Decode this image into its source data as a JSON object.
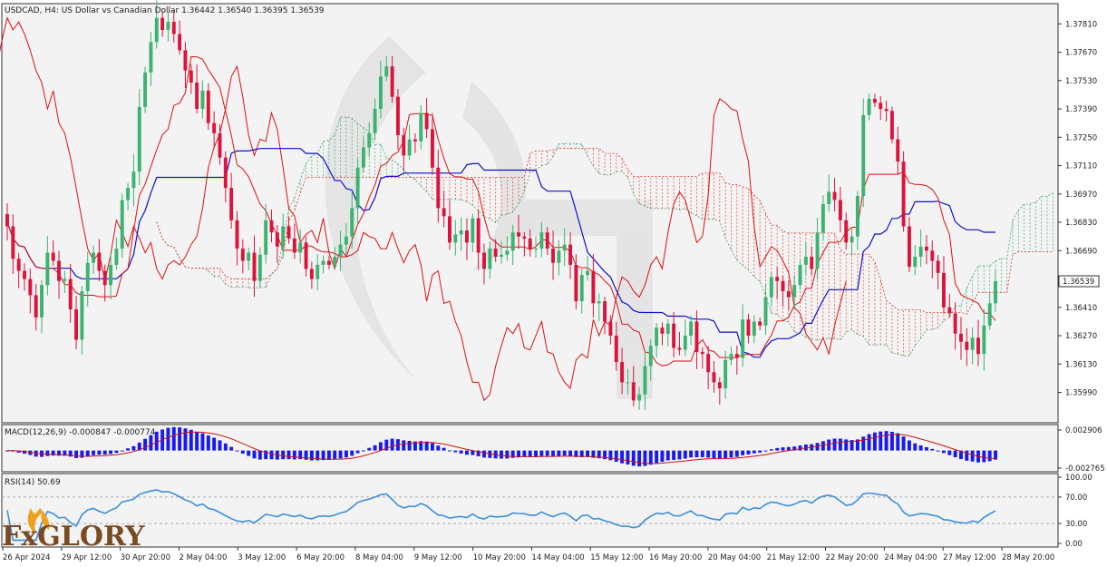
{
  "header": {
    "text": "USDCAD, H4:  US Dollar vs Canadian Dollar  1.36442 1.36540 1.36395 1.36539"
  },
  "logo": {
    "text": "FxGlory"
  },
  "colors": {
    "bull": "#3cb371",
    "bear": "#dc143c",
    "kijun": "#1010cc",
    "tenkan": "#dd1111",
    "cloud_bear": "#e0302a",
    "cloud_bull": "#3aa564",
    "macd_hist": "#1a1aee",
    "macd_signal": "#cc1111",
    "rsi": "#3c8fdc",
    "background": "#f3f3f3"
  },
  "chart_data": [
    {
      "type": "candlestick",
      "panel": "main",
      "symbol": "USDCAD",
      "timeframe": "H4",
      "description": "US Dollar vs Canadian Dollar",
      "last_price_label": "1.36539",
      "ylim": [
        1.3584,
        1.3791
      ],
      "y_ticks": [
        "1.37810",
        "1.37670",
        "1.37530",
        "1.37390",
        "1.37250",
        "1.37110",
        "1.36970",
        "1.36830",
        "1.36690",
        "1.36539",
        "1.36410",
        "1.36270",
        "1.36130",
        "1.35990"
      ],
      "x_labels": [
        "26 Apr 2024",
        "29 Apr 12:00",
        "30 Apr 20:00",
        "2 May 04:00",
        "3 May 12:00",
        "6 May 20:00",
        "8 May 04:00",
        "9 May 12:00",
        "10 May 20:00",
        "14 May 04:00",
        "15 May 12:00",
        "16 May 20:00",
        "20 May 04:00",
        "21 May 12:00",
        "22 May 20:00",
        "24 May 04:00",
        "27 May 12:00",
        "28 May 20:00"
      ],
      "close": [
        1.3681,
        1.3665,
        1.3659,
        1.3655,
        1.3647,
        1.3636,
        1.3652,
        1.3668,
        1.3664,
        1.3654,
        1.3655,
        1.364,
        1.3625,
        1.3649,
        1.3663,
        1.3668,
        1.3659,
        1.3652,
        1.3662,
        1.367,
        1.3694,
        1.37,
        1.3708,
        1.374,
        1.3757,
        1.3772,
        1.3784,
        1.3778,
        1.3782,
        1.3776,
        1.3768,
        1.3758,
        1.3752,
        1.3739,
        1.3748,
        1.3732,
        1.3727,
        1.3715,
        1.37,
        1.3684,
        1.367,
        1.3664,
        1.3668,
        1.3654,
        1.3667,
        1.3684,
        1.3678,
        1.3671,
        1.3681,
        1.3675,
        1.3668,
        1.3673,
        1.366,
        1.3655,
        1.3662,
        1.3664,
        1.3662,
        1.3666,
        1.3672,
        1.3676,
        1.369,
        1.371,
        1.372,
        1.3727,
        1.3739,
        1.3755,
        1.376,
        1.3745,
        1.3726,
        1.3716,
        1.3724,
        1.3723,
        1.3737,
        1.3729,
        1.371,
        1.369,
        1.3686,
        1.3673,
        1.3677,
        1.3679,
        1.3673,
        1.3685,
        1.3668,
        1.366,
        1.367,
        1.3666,
        1.3667,
        1.3669,
        1.3678,
        1.3676,
        1.3675,
        1.367,
        1.367,
        1.3678,
        1.367,
        1.3663,
        1.3669,
        1.3672,
        1.3662,
        1.3644,
        1.3657,
        1.3659,
        1.3643,
        1.3644,
        1.3634,
        1.3627,
        1.3614,
        1.3604,
        1.3604,
        1.3595,
        1.3598,
        1.3612,
        1.3622,
        1.3631,
        1.3628,
        1.3633,
        1.3621,
        1.362,
        1.3627,
        1.3634,
        1.3619,
        1.3618,
        1.3609,
        1.3604,
        1.3601,
        1.3615,
        1.3618,
        1.3616,
        1.3635,
        1.3627,
        1.3634,
        1.3632,
        1.3646,
        1.3656,
        1.3654,
        1.3649,
        1.3646,
        1.3652,
        1.3662,
        1.3666,
        1.366,
        1.3678,
        1.3692,
        1.3698,
        1.3694,
        1.3684,
        1.3673,
        1.3676,
        1.3696,
        1.3736,
        1.3744,
        1.3742,
        1.3739,
        1.3738,
        1.3724,
        1.3713,
        1.3681,
        1.3661,
        1.3666,
        1.3671,
        1.3669,
        1.3664,
        1.3658,
        1.3641,
        1.3638,
        1.3628,
        1.3624,
        1.362,
        1.3626,
        1.3618,
        1.3632,
        1.3643,
        1.36539
      ],
      "x_count": 182
    },
    {
      "type": "bar",
      "panel": "MACD",
      "label": "MACD(12,26,9) -0.000847 -0.000774",
      "y_ticks": [
        "0.002906",
        "-0.002765"
      ],
      "ylim": [
        -0.003,
        0.0031
      ],
      "note": "histogram values oscillate between approx -0.0026 and 0.0029"
    },
    {
      "type": "line",
      "panel": "RSI",
      "label": "RSI(14) 50.69",
      "ylim": [
        0,
        100
      ],
      "y_ticks": [
        "100.00",
        "70.00",
        "30.00",
        "0.00"
      ],
      "levels": [
        70,
        30
      ]
    }
  ]
}
